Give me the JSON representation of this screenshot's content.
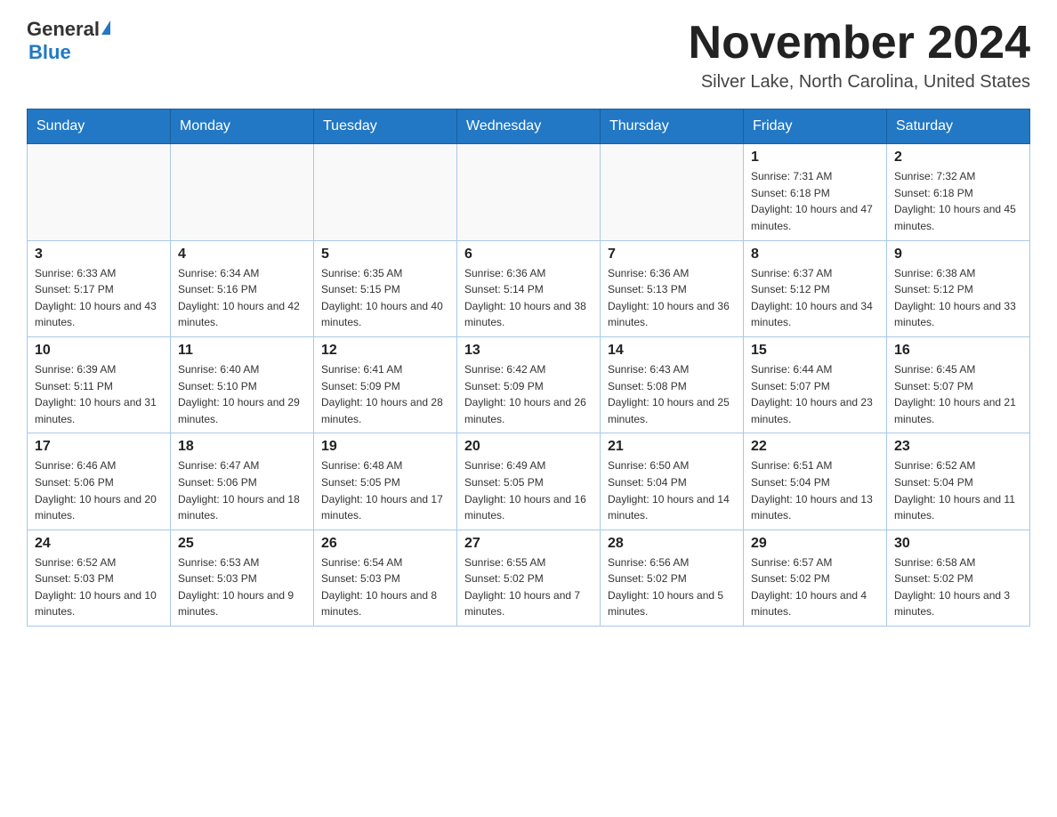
{
  "header": {
    "logo_general": "General",
    "logo_blue": "Blue",
    "month_title": "November 2024",
    "location": "Silver Lake, North Carolina, United States"
  },
  "weekdays": [
    "Sunday",
    "Monday",
    "Tuesday",
    "Wednesday",
    "Thursday",
    "Friday",
    "Saturday"
  ],
  "weeks": [
    [
      {
        "day": "",
        "info": ""
      },
      {
        "day": "",
        "info": ""
      },
      {
        "day": "",
        "info": ""
      },
      {
        "day": "",
        "info": ""
      },
      {
        "day": "",
        "info": ""
      },
      {
        "day": "1",
        "info": "Sunrise: 7:31 AM\nSunset: 6:18 PM\nDaylight: 10 hours and 47 minutes."
      },
      {
        "day": "2",
        "info": "Sunrise: 7:32 AM\nSunset: 6:18 PM\nDaylight: 10 hours and 45 minutes."
      }
    ],
    [
      {
        "day": "3",
        "info": "Sunrise: 6:33 AM\nSunset: 5:17 PM\nDaylight: 10 hours and 43 minutes."
      },
      {
        "day": "4",
        "info": "Sunrise: 6:34 AM\nSunset: 5:16 PM\nDaylight: 10 hours and 42 minutes."
      },
      {
        "day": "5",
        "info": "Sunrise: 6:35 AM\nSunset: 5:15 PM\nDaylight: 10 hours and 40 minutes."
      },
      {
        "day": "6",
        "info": "Sunrise: 6:36 AM\nSunset: 5:14 PM\nDaylight: 10 hours and 38 minutes."
      },
      {
        "day": "7",
        "info": "Sunrise: 6:36 AM\nSunset: 5:13 PM\nDaylight: 10 hours and 36 minutes."
      },
      {
        "day": "8",
        "info": "Sunrise: 6:37 AM\nSunset: 5:12 PM\nDaylight: 10 hours and 34 minutes."
      },
      {
        "day": "9",
        "info": "Sunrise: 6:38 AM\nSunset: 5:12 PM\nDaylight: 10 hours and 33 minutes."
      }
    ],
    [
      {
        "day": "10",
        "info": "Sunrise: 6:39 AM\nSunset: 5:11 PM\nDaylight: 10 hours and 31 minutes."
      },
      {
        "day": "11",
        "info": "Sunrise: 6:40 AM\nSunset: 5:10 PM\nDaylight: 10 hours and 29 minutes."
      },
      {
        "day": "12",
        "info": "Sunrise: 6:41 AM\nSunset: 5:09 PM\nDaylight: 10 hours and 28 minutes."
      },
      {
        "day": "13",
        "info": "Sunrise: 6:42 AM\nSunset: 5:09 PM\nDaylight: 10 hours and 26 minutes."
      },
      {
        "day": "14",
        "info": "Sunrise: 6:43 AM\nSunset: 5:08 PM\nDaylight: 10 hours and 25 minutes."
      },
      {
        "day": "15",
        "info": "Sunrise: 6:44 AM\nSunset: 5:07 PM\nDaylight: 10 hours and 23 minutes."
      },
      {
        "day": "16",
        "info": "Sunrise: 6:45 AM\nSunset: 5:07 PM\nDaylight: 10 hours and 21 minutes."
      }
    ],
    [
      {
        "day": "17",
        "info": "Sunrise: 6:46 AM\nSunset: 5:06 PM\nDaylight: 10 hours and 20 minutes."
      },
      {
        "day": "18",
        "info": "Sunrise: 6:47 AM\nSunset: 5:06 PM\nDaylight: 10 hours and 18 minutes."
      },
      {
        "day": "19",
        "info": "Sunrise: 6:48 AM\nSunset: 5:05 PM\nDaylight: 10 hours and 17 minutes."
      },
      {
        "day": "20",
        "info": "Sunrise: 6:49 AM\nSunset: 5:05 PM\nDaylight: 10 hours and 16 minutes."
      },
      {
        "day": "21",
        "info": "Sunrise: 6:50 AM\nSunset: 5:04 PM\nDaylight: 10 hours and 14 minutes."
      },
      {
        "day": "22",
        "info": "Sunrise: 6:51 AM\nSunset: 5:04 PM\nDaylight: 10 hours and 13 minutes."
      },
      {
        "day": "23",
        "info": "Sunrise: 6:52 AM\nSunset: 5:04 PM\nDaylight: 10 hours and 11 minutes."
      }
    ],
    [
      {
        "day": "24",
        "info": "Sunrise: 6:52 AM\nSunset: 5:03 PM\nDaylight: 10 hours and 10 minutes."
      },
      {
        "day": "25",
        "info": "Sunrise: 6:53 AM\nSunset: 5:03 PM\nDaylight: 10 hours and 9 minutes."
      },
      {
        "day": "26",
        "info": "Sunrise: 6:54 AM\nSunset: 5:03 PM\nDaylight: 10 hours and 8 minutes."
      },
      {
        "day": "27",
        "info": "Sunrise: 6:55 AM\nSunset: 5:02 PM\nDaylight: 10 hours and 7 minutes."
      },
      {
        "day": "28",
        "info": "Sunrise: 6:56 AM\nSunset: 5:02 PM\nDaylight: 10 hours and 5 minutes."
      },
      {
        "day": "29",
        "info": "Sunrise: 6:57 AM\nSunset: 5:02 PM\nDaylight: 10 hours and 4 minutes."
      },
      {
        "day": "30",
        "info": "Sunrise: 6:58 AM\nSunset: 5:02 PM\nDaylight: 10 hours and 3 minutes."
      }
    ]
  ]
}
